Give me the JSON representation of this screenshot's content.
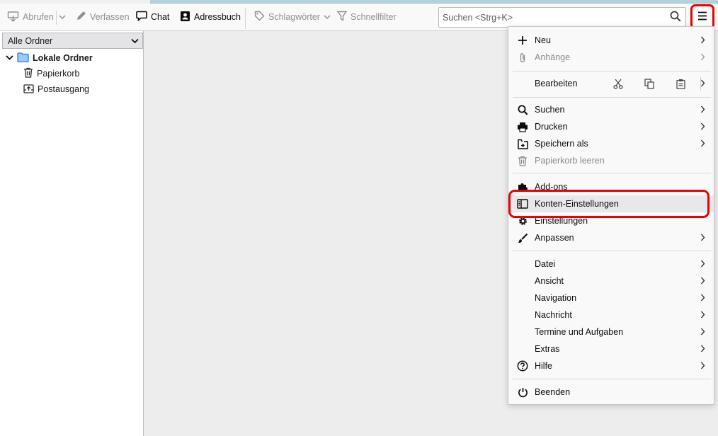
{
  "toolbar": {
    "get_messages_label": "Abrufen",
    "write_label": "Verfassen",
    "chat_label": "Chat",
    "address_book_label": "Adressbuch",
    "tags_label": "Schlagwörter",
    "quick_filter_label": "Schnellfilter"
  },
  "search": {
    "placeholder": "Suchen <Strg+K>",
    "value": ""
  },
  "folder_pane": {
    "header": "Alle Ordner",
    "account": "Lokale Ordner",
    "folders": [
      "Papierkorb",
      "Postausgang"
    ]
  },
  "app_menu": {
    "new": "Neu",
    "attachments": "Anhänge",
    "edit": "Bearbeiten",
    "find": "Suchen",
    "print": "Drucken",
    "save_as": "Speichern als",
    "empty_trash": "Papierkorb leeren",
    "addons": "Add-ons",
    "account_settings": "Konten-Einstellungen",
    "settings": "Einstellungen",
    "customize": "Anpassen",
    "file": "Datei",
    "view": "Ansicht",
    "navigation": "Navigation",
    "message": "Nachricht",
    "events_tasks": "Termine und Aufgaben",
    "tools": "Extras",
    "help": "Hilfe",
    "quit": "Beenden"
  },
  "colors": {
    "highlight_annotation": "#ec0000",
    "folder_icon": "#2a7fd4",
    "tab_edge": "#b5d1dc"
  }
}
